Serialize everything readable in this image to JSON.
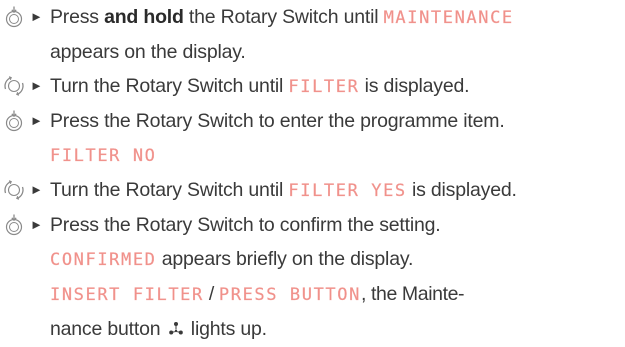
{
  "arrow_glyph": "►",
  "steps": [
    {
      "icon": "rotary-press-icon",
      "parts": {
        "p1": "Press ",
        "bold": "and hold",
        "p2": " the Rotary Switch until ",
        "display1": "MAINTENANCE",
        "line2": "appears on the display."
      }
    },
    {
      "icon": "rotary-turn-icon",
      "parts": {
        "p1": "Turn the Rotary Switch until ",
        "display1": "FILTER",
        "p2": " is displayed."
      }
    },
    {
      "icon": "rotary-press-icon",
      "parts": {
        "p1": "Press the Rotary Switch to enter the programme item.",
        "display1": "FILTER NO"
      }
    },
    {
      "icon": "rotary-turn-icon",
      "parts": {
        "p1": "Turn the Rotary Switch until ",
        "display1": "FILTER YES",
        "p2": " is displayed."
      }
    },
    {
      "icon": "rotary-press-icon",
      "parts": {
        "p1": "Press the Rotary Switch to confirm the setting.",
        "display1": "CONFIRMED",
        "p2": " appears briefly on the display.",
        "display2": "INSERT FILTER",
        "sep": " / ",
        "display3": "PRESS BUTTON",
        "p3": ", the Mainte-",
        "p4": "nance button ",
        "p5": " lights up."
      }
    }
  ],
  "colors": {
    "text": "#3a3a3a",
    "display": "#f0908a",
    "icon": "#8a8a8a"
  }
}
